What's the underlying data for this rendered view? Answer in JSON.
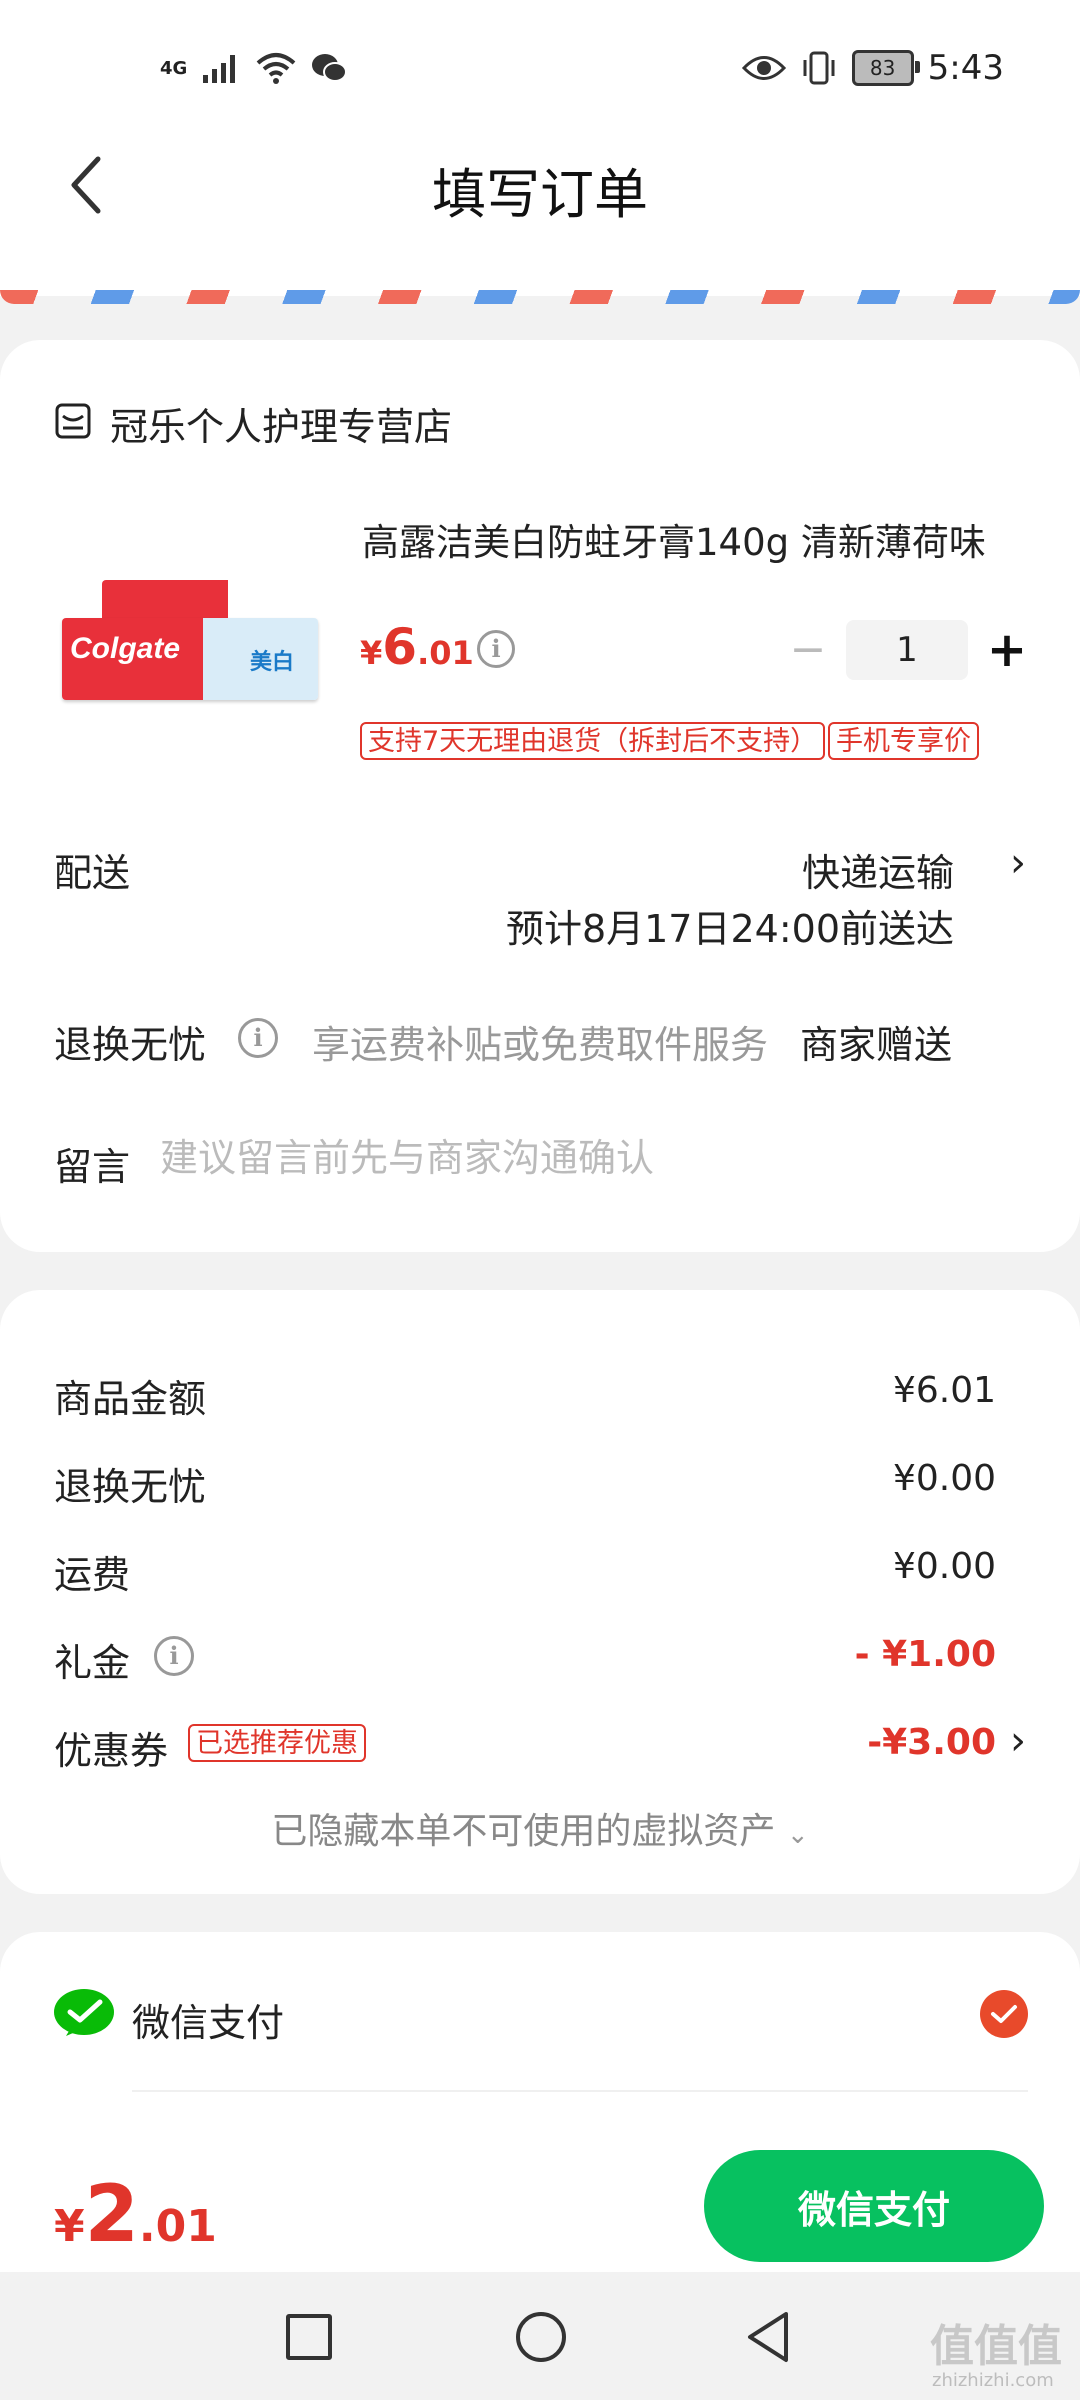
{
  "status_bar": {
    "network": "4G",
    "battery": "83",
    "time": "5:43"
  },
  "header": {
    "title": "填写订单"
  },
  "shop": {
    "name": "冠乐个人护理专营店"
  },
  "product": {
    "name": "高露洁美白防蛀牙膏140g 清新薄荷味",
    "image_text": "Colgate",
    "image_badge": "美白",
    "price_symbol": "¥",
    "price_int": "6",
    "price_dec": ".01",
    "quantity": "1",
    "minus": "−",
    "plus": "+",
    "tags": [
      "支持7天无理由退货（拆封后不支持）",
      "手机专享价"
    ]
  },
  "delivery": {
    "label": "配送",
    "method": "快递运输",
    "estimate": "预计8月17日24:00前送达"
  },
  "return_service": {
    "label": "退换无忧",
    "desc": "享运费补贴或免费取件服务",
    "value": "商家赠送"
  },
  "message": {
    "label": "留言",
    "placeholder": "建议留言前先与商家沟通确认"
  },
  "summary": {
    "items": [
      {
        "label": "商品金额",
        "value": "¥6.01"
      },
      {
        "label": "退换无忧",
        "value": "¥0.00"
      },
      {
        "label": "运费",
        "value": "¥0.00"
      },
      {
        "label": "礼金",
        "value": "- ¥1.00"
      },
      {
        "label": "优惠券",
        "value": "-¥3.00",
        "badge": "已选推荐优惠"
      }
    ],
    "hidden_assets": "已隐藏本单不可使用的虚拟资产"
  },
  "payment": {
    "method": "微信支付"
  },
  "footer": {
    "total_symbol": "¥",
    "total_int": "2",
    "total_dec": ".01",
    "pay_button": "微信支付"
  },
  "watermark": {
    "text": "值值值",
    "url": "zhizhizhi.com"
  },
  "colors": {
    "accent_red": "#e0352b",
    "wechat_green": "#07c160",
    "background": "#f2f2f2"
  }
}
